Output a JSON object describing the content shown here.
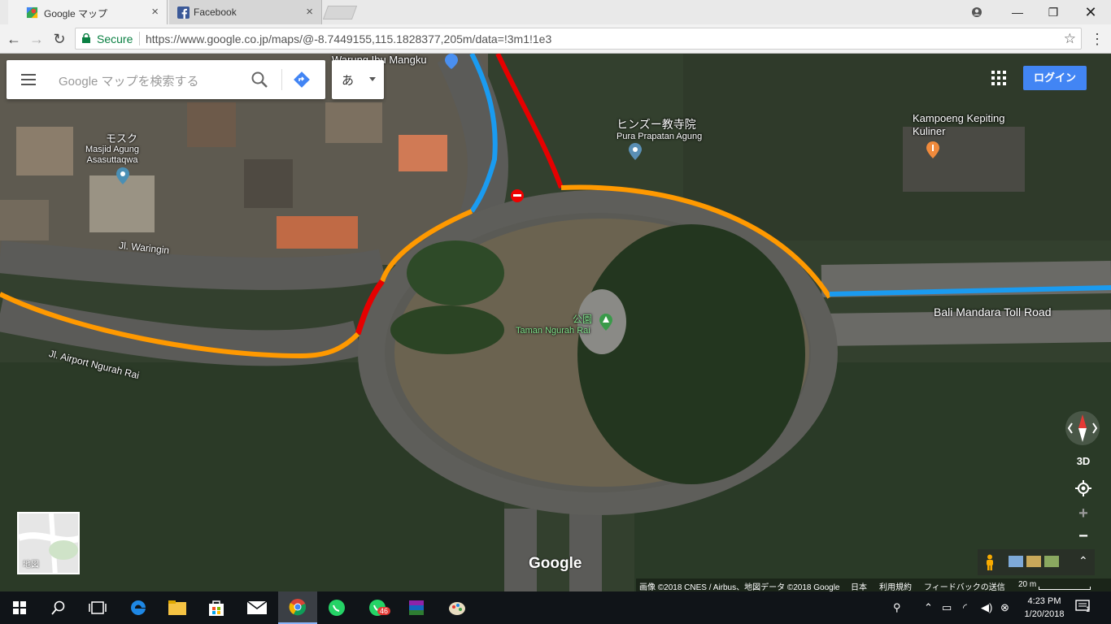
{
  "browser": {
    "tabs": [
      {
        "title": "Google マップ",
        "icon": "google-maps-icon",
        "active": true
      },
      {
        "title": "Facebook",
        "icon": "facebook-icon",
        "active": false
      }
    ],
    "secure_label": "Secure",
    "url": "https://www.google.co.jp/maps/@-8.7449155,115.1828377,205m/data=!3m1!1e3"
  },
  "map": {
    "search_placeholder": "Google マップを検索する",
    "ime_char": "あ",
    "login_label": "ログイン",
    "labels": {
      "warung": "Warung Ibu Mangku",
      "mosque_jp": "モスク",
      "mosque_name": "Masjid Agung Asasuttaqwa",
      "temple_jp": "ヒンズー教寺院",
      "temple_name": "Pura Prapatan Agung",
      "kampoeng": "Kampoeng Kepiting Kuliner",
      "waringin": "Jl. Waringin",
      "airport_road": "Jl. Airport Ngurah Rai",
      "toll_road": "Bali Mandara Toll Road",
      "park_jp": "公園",
      "park_name": "Taman Ngurah Rai"
    },
    "minimap_label": "地図",
    "controls": {
      "threed": "3D",
      "zoom_in": "+",
      "zoom_out": "−"
    },
    "google_logo": "Google",
    "footer": {
      "attribution": "画像 ©2018 CNES / Airbus、地図データ ©2018 Google",
      "country": "日本",
      "terms": "利用規約",
      "feedback": "フィードバックの送信",
      "scale": "20 m"
    },
    "traffic_colors": {
      "heavy": "#e60000",
      "moderate": "#ff9900",
      "selected": "#1a9bf0"
    }
  },
  "taskbar": {
    "time": "4:23 PM",
    "date": "1/20/2018",
    "whatsapp_badge": "46",
    "notification_count": "1",
    "apps": [
      "windows-start-icon",
      "search-icon",
      "task-view-icon",
      "edge-icon",
      "file-explorer-icon",
      "store-icon",
      "mail-icon",
      "chrome-icon",
      "whatsapp-icon",
      "whatsapp-icon",
      "winrar-icon",
      "paint-icon"
    ]
  }
}
